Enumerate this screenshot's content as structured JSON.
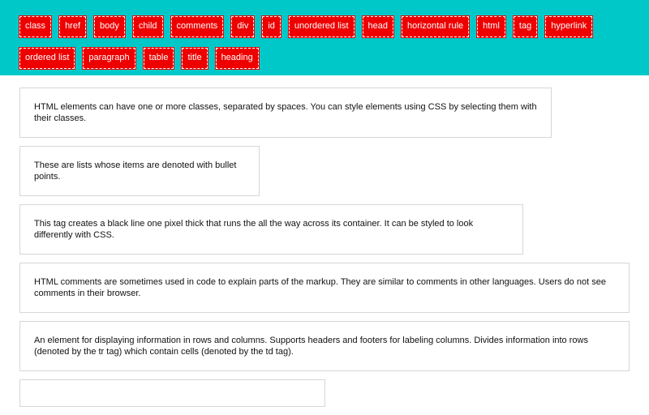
{
  "tags": [
    "class",
    "href",
    "body",
    "child",
    "comments",
    "div",
    "id",
    "unordered list",
    "head",
    "horizontal rule",
    "html",
    "tag",
    "hyperlink",
    "ordered list",
    "paragraph",
    "table",
    "title",
    "heading"
  ],
  "cards": [
    "HTML elements can have one or more classes, separated by spaces. You can style elements using CSS by selecting them with their classes.",
    "These are lists whose items are denoted with bullet points.",
    "This tag creates a black line one pixel thick that runs the all the way across its container. It can be styled to look differently with CSS.",
    "HTML comments are sometimes used in code to explain parts of the markup. They are similar to comments in other languages. Users do not see comments in their browser.",
    "An element for displaying information in rows and columns. Supports headers and footers for labeling columns. Divides information into rows (denoted by the tr tag) which contain cells (denoted by the td tag).",
    ""
  ],
  "colors": {
    "header_bg": "#00c8c8",
    "tag_bg": "#ee0000",
    "tag_text": "#ffffff"
  }
}
